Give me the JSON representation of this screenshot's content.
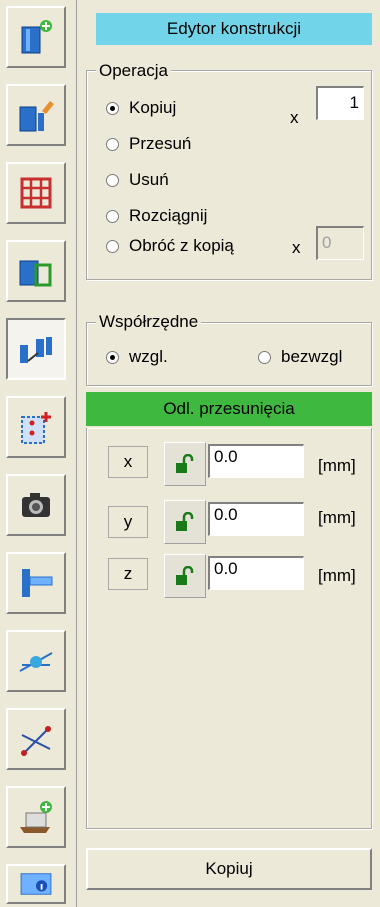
{
  "panel_title": "Edytor konstrukcji",
  "operation": {
    "legend": "Operacja",
    "options": [
      "Kopiuj",
      "Przesuń",
      "Usuń",
      "Rozciągnij",
      "Obróć z kopią"
    ],
    "selected": "Kopiuj",
    "count_label": "x",
    "count_value": "1",
    "rotate_label": "x",
    "rotate_value": "0"
  },
  "coords": {
    "legend": "Współrzędne",
    "options": [
      "wzgl.",
      "bezwzgl"
    ],
    "selected": "wzgl."
  },
  "offset_header": "Odl. przesunięcia",
  "offsets": [
    {
      "axis": "x",
      "value": "0.0",
      "unit": "[mm]"
    },
    {
      "axis": "y",
      "value": "0.0",
      "unit": "[mm]"
    },
    {
      "axis": "z",
      "value": "0.0",
      "unit": "[mm]"
    }
  ],
  "action_button": "Kopiuj",
  "toolbar_icons": [
    "add-column-icon",
    "edit-column-icon",
    "grid-icon",
    "copy-frame-icon",
    "move-frame-icon",
    "add-node-icon",
    "camera-icon",
    "connect-beam-icon",
    "node-icon",
    "diagonal-icon",
    "add-block-icon",
    "info-icon"
  ],
  "toolbar_active_index": 4
}
